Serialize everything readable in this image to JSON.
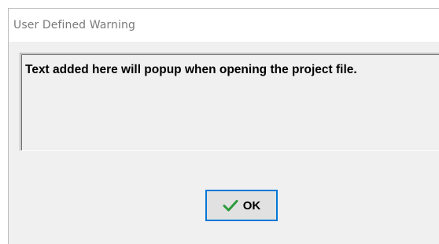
{
  "window": {
    "title": "User Defined Warning"
  },
  "message": {
    "text": "Text added here will popup when opening the project file."
  },
  "buttons": {
    "ok_label": "OK",
    "ok_icon": "checkmark-icon",
    "ok_icon_color": "#2e9a3a",
    "focus_border_color": "#0078d7"
  }
}
